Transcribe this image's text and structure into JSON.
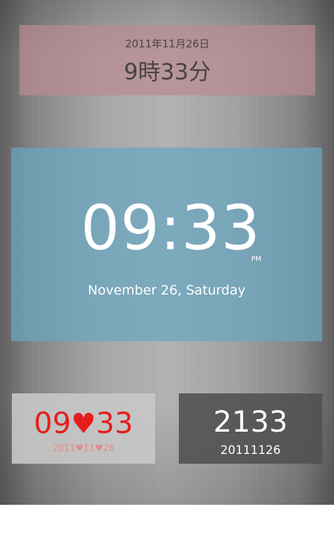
{
  "widgets": {
    "jp_clock": {
      "date": "2011年11月26日",
      "time": "9時33分",
      "background": "#b98a94"
    },
    "big_clock": {
      "time": "09:33",
      "ampm": "PM",
      "date": "November 26, Saturday",
      "background": "#68a6c0"
    },
    "heart_clock": {
      "hour": "09",
      "minute": "33",
      "heart_glyph": "♥",
      "year": "2011",
      "month": "11",
      "day": "26",
      "color": "#e41e1e"
    },
    "numeric_clock": {
      "time": "2133",
      "date": "20111126"
    }
  }
}
